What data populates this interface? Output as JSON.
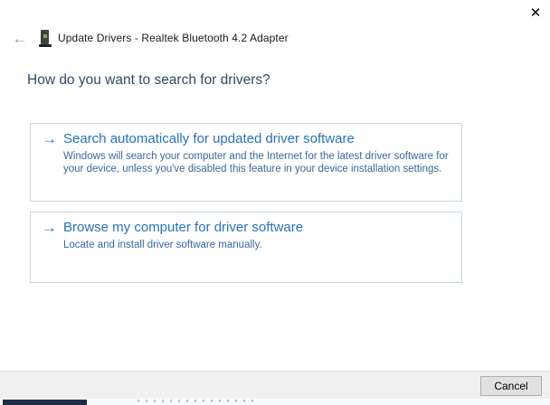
{
  "window": {
    "title": "Update Drivers - Realtek Bluetooth 4.2 Adapter",
    "close_icon": "✕",
    "back_icon": "←"
  },
  "main": {
    "heading": "How do you want to search for drivers?",
    "options": [
      {
        "arrow_icon": "→",
        "title": "Search automatically for updated driver software",
        "description": "Windows will search your computer and the Internet for the latest driver software for your device, unless you've disabled this feature in your device installation settings."
      },
      {
        "arrow_icon": "→",
        "title": "Browse my computer for driver software",
        "description": "Locate and install driver software manually."
      }
    ]
  },
  "footer": {
    "cancel_label": "Cancel"
  },
  "colors": {
    "heading_text": "#2b4b68",
    "option_title": "#2a72b8",
    "option_description": "#38679b",
    "option_border": "#c3d5e0",
    "footer_background": "#f0f0f0",
    "button_background": "#e1e1e1",
    "button_border": "#adadad",
    "taskbar_navy": "#1d2c47"
  }
}
